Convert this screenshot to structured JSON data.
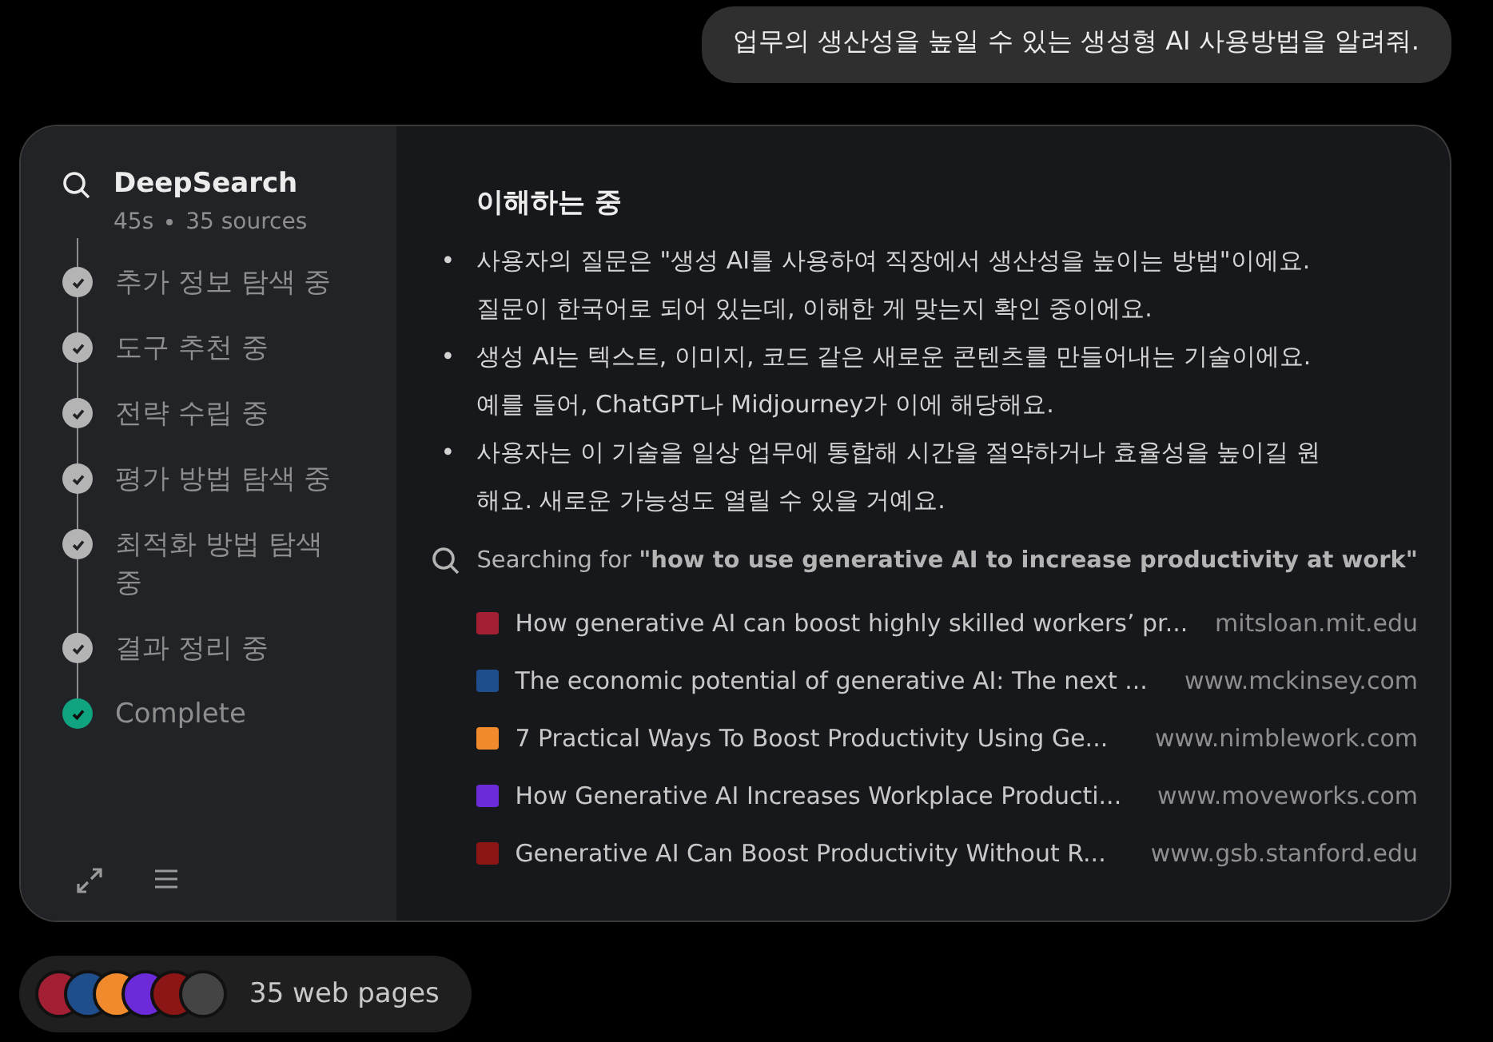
{
  "user_message": "업무의 생산성을 높일 수 있는 생성형 AI 사용방법을 알려줘.",
  "sidebar": {
    "title": "DeepSearch",
    "duration": "45s",
    "sources": "35 sources",
    "steps": [
      {
        "label": "추가 정보 탐색 중",
        "kind": "done"
      },
      {
        "label": "도구 추천 중",
        "kind": "done"
      },
      {
        "label": "전략 수립 중",
        "kind": "done"
      },
      {
        "label": "평가 방법 탐색 중",
        "kind": "done"
      },
      {
        "label": "최적화 방법 탐색 중",
        "kind": "done"
      },
      {
        "label": "결과 정리 중",
        "kind": "done"
      },
      {
        "label": "Complete",
        "kind": "complete"
      }
    ]
  },
  "content": {
    "heading": "이해하는 중",
    "bullets": [
      {
        "marker": "•",
        "text": "사용자의 질문은 \"생성 AI를 사용하여 직장에서 생산성을 높이는 방법\"이에요. 질문이 한국어로 되어 있는데, 이해한 게 맞는지 확인 중이에요."
      },
      {
        "marker": "•",
        "text": "생성 AI는 텍스트, 이미지, 코드 같은 새로운 콘텐츠를 만들어내는 기술이에요. 예를 들어, ChatGPT나 Midjourney가 이에 해당해요."
      },
      {
        "marker": "•",
        "text": "사용자는 이 기술을 일상 업무에 통합해 시간을 절약하거나 효율성을 높이길 원해요. 새로운 가능성도 열릴 수 있을 거예요."
      }
    ],
    "search_query": "Searching for **\"how to use generative AI to increase productivity at work\"**",
    "results": [
      {
        "title": "How generative AI can boost highly skilled workers’ pr...",
        "domain": "mitsloan.mit.edu",
        "color": "#a31f34"
      },
      {
        "title": "The economic potential of generative AI: The next ...",
        "domain": "www.mckinsey.com",
        "color": "#1f4e8c"
      },
      {
        "title": "7 Practical Ways To Boost Productivity Using Ge...",
        "domain": "www.nimblework.com",
        "color": "#f08a2c"
      },
      {
        "title": "How Generative AI Increases Workplace Producti...",
        "domain": "www.moveworks.com",
        "color": "#6b2bd9"
      },
      {
        "title": "Generative AI Can Boost Productivity Without R...",
        "domain": "www.gsb.stanford.edu",
        "color": "#8c1515"
      }
    ]
  },
  "web_pages": {
    "label": "35 web pages",
    "favicons": [
      {
        "color": "#a31f34"
      },
      {
        "color": "#1f4e8c"
      },
      {
        "color": "#f08a2c"
      },
      {
        "color": "#6b2bd9"
      },
      {
        "color": "#8c1515"
      },
      {
        "color": "#444444"
      }
    ]
  }
}
